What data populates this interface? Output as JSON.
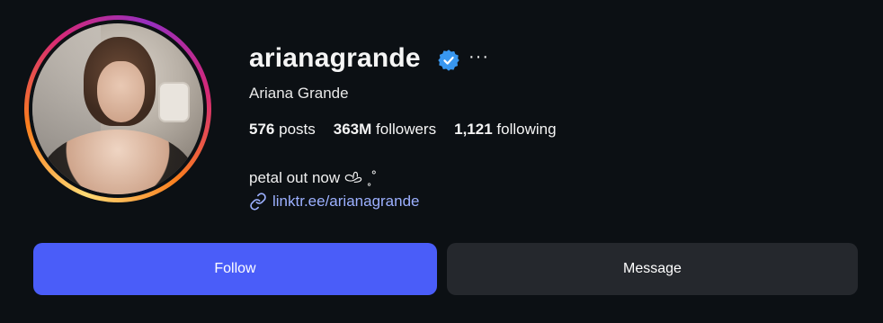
{
  "profile": {
    "username": "arianagrande",
    "full_name": "Ariana Grande",
    "verified": true,
    "more_label": "···",
    "stats": {
      "posts_count": "576",
      "posts_label": "posts",
      "followers_count": "363M",
      "followers_label": "followers",
      "following_count": "1,121",
      "following_label": "following"
    },
    "bio": "petal out now 𐚁 ˳˚",
    "link_text": "linktr.ee/arianagrande"
  },
  "buttons": {
    "follow_label": "Follow",
    "message_label": "Message"
  },
  "colors": {
    "background": "#0c1014",
    "follow_button": "#4a5df9",
    "message_button": "#25282d",
    "link": "#9cb0ff",
    "verified_badge": "#3897f0"
  },
  "icons": [
    "verified-badge-icon",
    "more-options-icon",
    "link-icon"
  ]
}
